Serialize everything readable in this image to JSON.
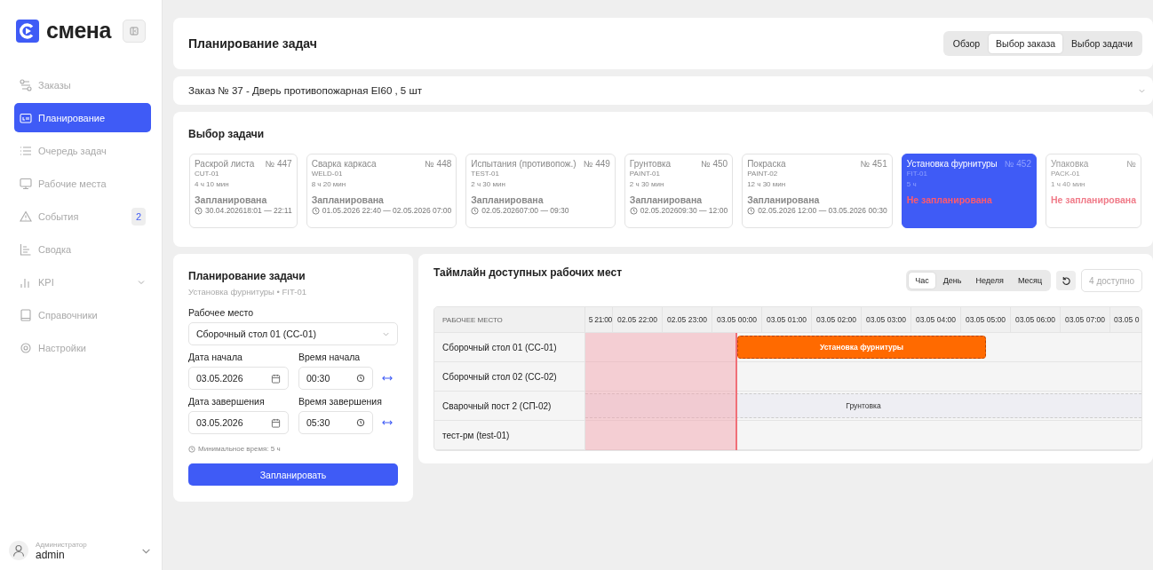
{
  "brand": {
    "name": "смена"
  },
  "nav": [
    {
      "label": "Заказы",
      "selected": false
    },
    {
      "label": "Планирование",
      "selected": true
    },
    {
      "label": "Очередь задач",
      "selected": false
    },
    {
      "label": "Рабочие места",
      "selected": false
    },
    {
      "label": "События",
      "selected": false,
      "badge": "2"
    },
    {
      "label": "Сводка",
      "selected": false
    },
    {
      "label": "KPI",
      "selected": false,
      "expanded": false
    },
    {
      "label": "Справочники",
      "selected": false
    },
    {
      "label": "Настройки",
      "selected": false
    }
  ],
  "user": {
    "role": "Администратор",
    "name": "admin"
  },
  "header": {
    "title": "Планирование задач",
    "tabs": [
      {
        "label": "Обзор",
        "selected": false
      },
      {
        "label": "Выбор заказа",
        "selected": true
      },
      {
        "label": "Выбор задачи",
        "selected": false
      }
    ]
  },
  "order": {
    "title": "Заказ № 37 - Дверь противопожарная EI60 , 5 шт",
    "expanded": false
  },
  "task_selection": {
    "title": "Выбор задачи",
    "tasks": [
      {
        "name": "Раскрой листа",
        "number": "№ 447",
        "code": "CUT-01",
        "duration": "4 ч 10 мин",
        "status": "Запланирована",
        "scheduled": true,
        "time": "30.04.202618:01 — 22:11",
        "selected": false,
        "disabled": false
      },
      {
        "name": "Сварка каркаса",
        "number": "№ 448",
        "code": "WELD-01",
        "duration": "8 ч 20 мин",
        "status": "Запланирована",
        "scheduled": true,
        "time": "01.05.2026 22:40 — 02.05.2026 07:00",
        "selected": false,
        "disabled": false
      },
      {
        "name": "Испытания (противопож.)",
        "number": "№ 449",
        "code": "TEST-01",
        "duration": "2 ч 30 мин",
        "status": "Запланирована",
        "scheduled": true,
        "time": "02.05.202607:00 — 09:30",
        "selected": false,
        "disabled": false
      },
      {
        "name": "Грунтовка",
        "number": "№ 450",
        "code": "PAINT-01",
        "duration": "2 ч 30 мин",
        "status": "Запланирована",
        "scheduled": true,
        "time": "02.05.202609:30 — 12:00",
        "selected": false,
        "disabled": false
      },
      {
        "name": "Покраска",
        "number": "№ 451",
        "code": "PAINT-02",
        "duration": "12 ч 30 мин",
        "status": "Запланирована",
        "scheduled": true,
        "time": "02.05.2026 12:00 — 03.05.2026 00:30",
        "selected": false,
        "disabled": false
      },
      {
        "name": "Установка фурнитуры",
        "number": "№ 452",
        "code": "FIT-01",
        "duration": "5 ч",
        "status": "Не запланирована",
        "scheduled": false,
        "selected": true,
        "disabled": false
      },
      {
        "name": "Упаковка",
        "number": "№",
        "code": "PACK-01",
        "duration": "1 ч 40 мин",
        "status": "Не запланирована",
        "scheduled": false,
        "selected": false,
        "disabled": true
      }
    ]
  },
  "planning": {
    "title": "Планирование задачи",
    "subtitle": "Установка фурнитуры • FIT-01",
    "workplace_label": "Рабочее место",
    "workplace": "Сборочный стол 01 (СС-01)",
    "start_date_label": "Дата начала",
    "start_date": "03.05.2026",
    "start_time_label": "Время начала",
    "start_time": "00:30",
    "end_date_label": "Дата завершения",
    "end_date": "03.05.2026",
    "end_time_label": "Время завершения",
    "end_time": "05:30",
    "hint": "Минимальное время: 5 ч",
    "submit": "Запланировать"
  },
  "timeline": {
    "title": "Таймлайн доступных рабочих мест",
    "scales": [
      {
        "label": "Час",
        "selected": true
      },
      {
        "label": "День",
        "selected": false
      },
      {
        "label": "Неделя",
        "selected": false
      },
      {
        "label": "Месяц",
        "selected": false
      }
    ],
    "available": "4 доступно",
    "column_header": "РАБОЧЕЕ МЕСТО",
    "hours": [
      "5 21:00",
      "02.05 22:00",
      "02.05 23:00",
      "03.05 00:00",
      "03.05 01:00",
      "03.05 02:00",
      "03.05 03:00",
      "03.05 04:00",
      "03.05 05:00",
      "03.05 06:00",
      "03.05 07:00",
      "03.05 0"
    ],
    "rows": [
      {
        "name": "Сборочный стол 01 (СС-01)",
        "bar": {
          "label": "Установка фурнитуры",
          "kind": "selected"
        }
      },
      {
        "name": "Сборочный стол 02 (СС-02)"
      },
      {
        "name": "Сварочный пост 2 (СП-02)",
        "bar": {
          "label": "Грунтовка",
          "kind": "busy"
        }
      },
      {
        "name": "тест-рм (test-01)"
      }
    ]
  }
}
